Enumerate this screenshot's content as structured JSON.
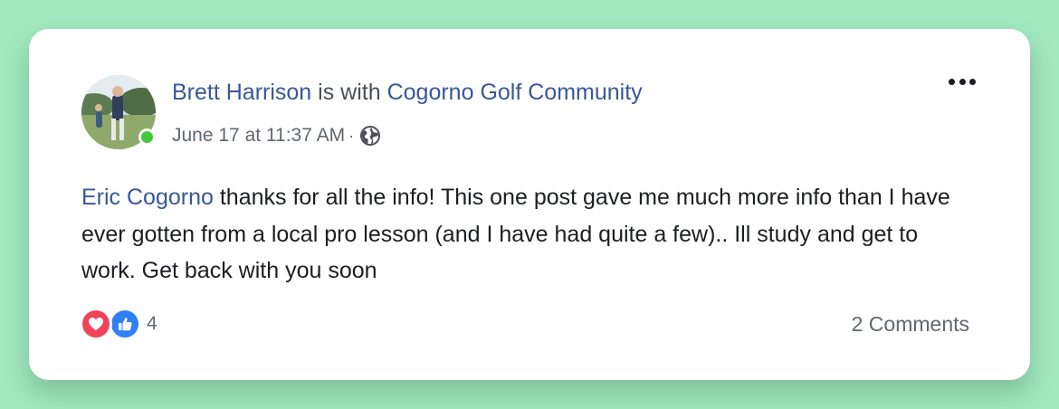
{
  "post": {
    "author": "Brett Harrison",
    "with_text": "is with",
    "group": "Cogorno Golf Community",
    "timestamp": "June 17 at 11:37 AM",
    "separator": "·",
    "audience_icon": "globe-icon",
    "mention": "Eric Cogorno",
    "body": " thanks for all the info! This one post gave me much more info than I have ever gotten from a local pro lesson (and I have had quite a few).. Ill study and get to work. Get back with you soon"
  },
  "reactions": {
    "icons": [
      "love-icon",
      "like-icon"
    ],
    "count": "4"
  },
  "comments": {
    "label": "2 Comments"
  },
  "colors": {
    "background": "#a1e7bf",
    "link": "#385898",
    "love": "#f0435b",
    "like": "#2f7ff5",
    "online": "#42c83a"
  }
}
